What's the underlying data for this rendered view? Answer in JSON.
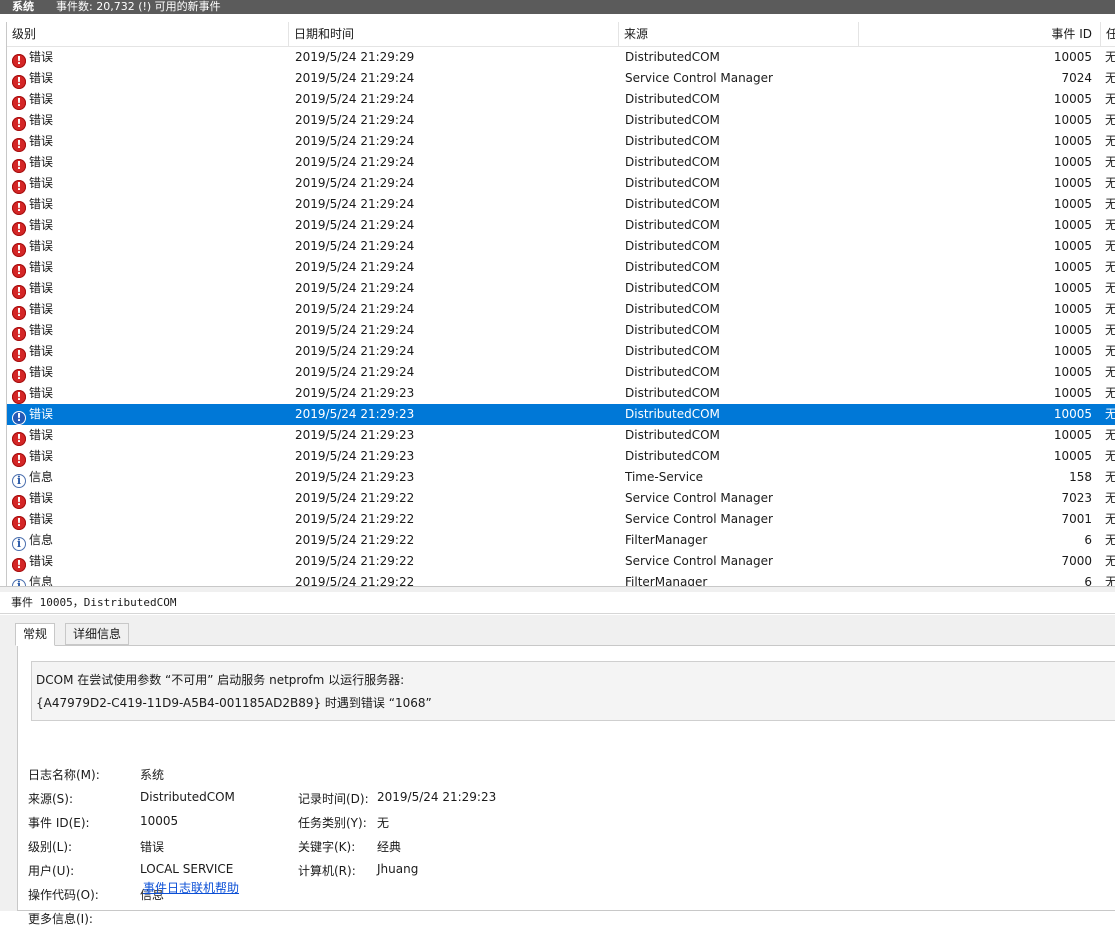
{
  "titlebar": {
    "log_name": "系统",
    "event_count": "事件数: 20,732 (!) 可用的新事件"
  },
  "table": {
    "columns": [
      "级别",
      "日期和时间",
      "来源",
      "事件 ID",
      "任"
    ],
    "selected_index": 17,
    "rows": [
      {
        "level": "错误",
        "icon": "error-icon",
        "date": "2019/5/24 21:29:29",
        "source": "DistributedCOM",
        "id": "10005",
        "task": "无"
      },
      {
        "level": "错误",
        "icon": "error-icon",
        "date": "2019/5/24 21:29:24",
        "source": "Service Control Manager",
        "id": "7024",
        "task": "无"
      },
      {
        "level": "错误",
        "icon": "error-icon",
        "date": "2019/5/24 21:29:24",
        "source": "DistributedCOM",
        "id": "10005",
        "task": "无"
      },
      {
        "level": "错误",
        "icon": "error-icon",
        "date": "2019/5/24 21:29:24",
        "source": "DistributedCOM",
        "id": "10005",
        "task": "无"
      },
      {
        "level": "错误",
        "icon": "error-icon",
        "date": "2019/5/24 21:29:24",
        "source": "DistributedCOM",
        "id": "10005",
        "task": "无"
      },
      {
        "level": "错误",
        "icon": "error-icon",
        "date": "2019/5/24 21:29:24",
        "source": "DistributedCOM",
        "id": "10005",
        "task": "无"
      },
      {
        "level": "错误",
        "icon": "error-icon",
        "date": "2019/5/24 21:29:24",
        "source": "DistributedCOM",
        "id": "10005",
        "task": "无"
      },
      {
        "level": "错误",
        "icon": "error-icon",
        "date": "2019/5/24 21:29:24",
        "source": "DistributedCOM",
        "id": "10005",
        "task": "无"
      },
      {
        "level": "错误",
        "icon": "error-icon",
        "date": "2019/5/24 21:29:24",
        "source": "DistributedCOM",
        "id": "10005",
        "task": "无"
      },
      {
        "level": "错误",
        "icon": "error-icon",
        "date": "2019/5/24 21:29:24",
        "source": "DistributedCOM",
        "id": "10005",
        "task": "无"
      },
      {
        "level": "错误",
        "icon": "error-icon",
        "date": "2019/5/24 21:29:24",
        "source": "DistributedCOM",
        "id": "10005",
        "task": "无"
      },
      {
        "level": "错误",
        "icon": "error-icon",
        "date": "2019/5/24 21:29:24",
        "source": "DistributedCOM",
        "id": "10005",
        "task": "无"
      },
      {
        "level": "错误",
        "icon": "error-icon",
        "date": "2019/5/24 21:29:24",
        "source": "DistributedCOM",
        "id": "10005",
        "task": "无"
      },
      {
        "level": "错误",
        "icon": "error-icon",
        "date": "2019/5/24 21:29:24",
        "source": "DistributedCOM",
        "id": "10005",
        "task": "无"
      },
      {
        "level": "错误",
        "icon": "error-icon",
        "date": "2019/5/24 21:29:24",
        "source": "DistributedCOM",
        "id": "10005",
        "task": "无"
      },
      {
        "level": "错误",
        "icon": "error-icon",
        "date": "2019/5/24 21:29:24",
        "source": "DistributedCOM",
        "id": "10005",
        "task": "无"
      },
      {
        "level": "错误",
        "icon": "error-icon",
        "date": "2019/5/24 21:29:23",
        "source": "DistributedCOM",
        "id": "10005",
        "task": "无"
      },
      {
        "level": "错误",
        "icon": "error-icon",
        "date": "2019/5/24 21:29:23",
        "source": "DistributedCOM",
        "id": "10005",
        "task": "无"
      },
      {
        "level": "错误",
        "icon": "error-icon",
        "date": "2019/5/24 21:29:23",
        "source": "DistributedCOM",
        "id": "10005",
        "task": "无"
      },
      {
        "level": "错误",
        "icon": "error-icon",
        "date": "2019/5/24 21:29:23",
        "source": "DistributedCOM",
        "id": "10005",
        "task": "无"
      },
      {
        "level": "信息",
        "icon": "info-icon",
        "date": "2019/5/24 21:29:23",
        "source": "Time-Service",
        "id": "158",
        "task": "无"
      },
      {
        "level": "错误",
        "icon": "error-icon",
        "date": "2019/5/24 21:29:22",
        "source": "Service Control Manager",
        "id": "7023",
        "task": "无"
      },
      {
        "level": "错误",
        "icon": "error-icon",
        "date": "2019/5/24 21:29:22",
        "source": "Service Control Manager",
        "id": "7001",
        "task": "无"
      },
      {
        "level": "信息",
        "icon": "info-icon",
        "date": "2019/5/24 21:29:22",
        "source": "FilterManager",
        "id": "6",
        "task": "无"
      },
      {
        "level": "错误",
        "icon": "error-icon",
        "date": "2019/5/24 21:29:22",
        "source": "Service Control Manager",
        "id": "7000",
        "task": "无"
      },
      {
        "level": "信息",
        "icon": "info-icon",
        "date": "2019/5/24 21:29:22",
        "source": "FilterManager",
        "id": "6",
        "task": "无"
      }
    ]
  },
  "detail": {
    "header": "事件 10005，DistributedCOM",
    "tabs": [
      "常规",
      "详细信息"
    ],
    "message_lines": [
      "DCOM 在尝试使用参数 “不可用” 启动服务 netprofm 以运行服务器:",
      "{A47979D2-C419-11D9-A5B4-001185AD2B89} 时遇到错误 “1068”"
    ],
    "labels": {
      "log_name": "日志名称(M):",
      "source": "来源(S):",
      "event_id": "事件 ID(E):",
      "level": "级别(L):",
      "user": "用户(U):",
      "opcode": "操作代码(O):",
      "more_info": "更多信息(I):",
      "logged": "记录时间(D):",
      "task_category": "任务类别(Y):",
      "keywords": "关键字(K):",
      "computer": "计算机(R):"
    },
    "values": {
      "log_name": "系统",
      "source": "DistributedCOM",
      "event_id": "10005",
      "level": "错误",
      "user": "LOCAL SERVICE",
      "opcode": "信息",
      "more_info_link": "事件日志联机帮助",
      "logged": "2019/5/24 21:29:23",
      "task_category": "无",
      "keywords": "经典",
      "computer": "Jhuang"
    }
  }
}
